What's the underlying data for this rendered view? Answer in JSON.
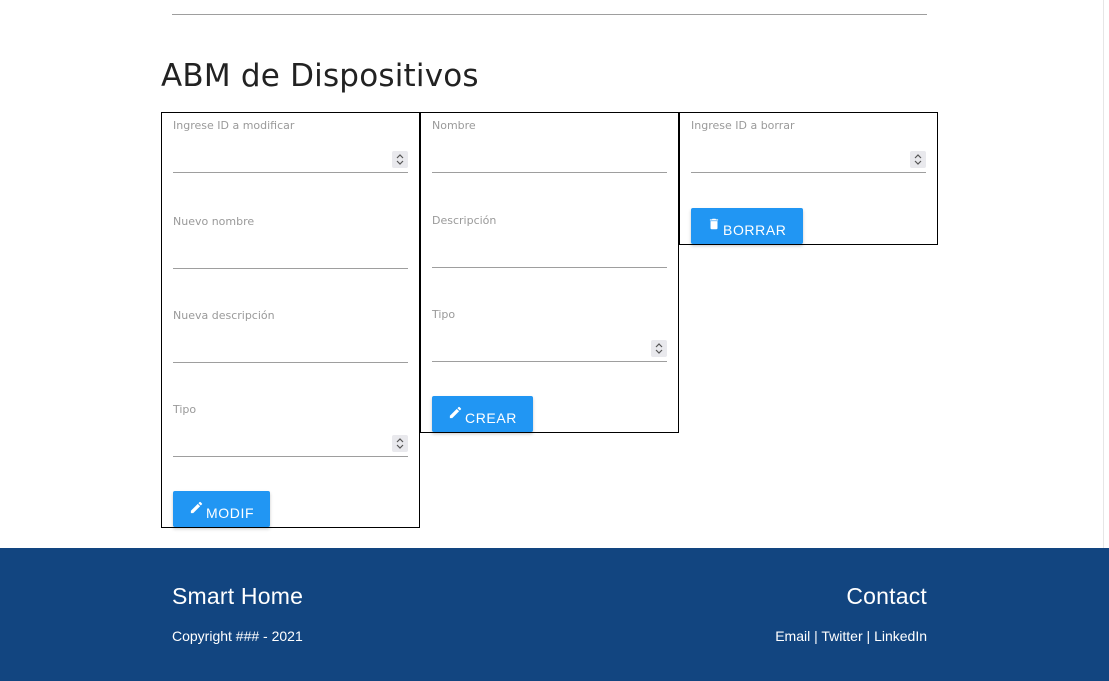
{
  "page": {
    "title": "ABM de Dispositivos"
  },
  "modify_panel": {
    "id_label": "Ingrese ID a modificar",
    "name_label": "Nuevo nombre",
    "description_label": "Nueva descripción",
    "type_label": "Tipo",
    "button_label": "MODIF",
    "button_icon": "pencil-icon"
  },
  "create_panel": {
    "name_label": "Nombre",
    "description_label": "Descripción",
    "type_label": "Tipo",
    "button_label": "CREAR",
    "button_icon": "pencil-icon"
  },
  "delete_panel": {
    "id_label": "Ingrese ID a borrar",
    "button_label": "BORRAR",
    "button_icon": "trash-icon"
  },
  "footer": {
    "brand": "Smart Home",
    "copyright": "Copyright ### - 2021",
    "contact_title": "Contact",
    "links": {
      "email": "Email",
      "twitter": "Twitter",
      "linkedin": "LinkedIn",
      "separator": "|"
    }
  },
  "colors": {
    "primary_button": "#2196f3",
    "footer_background": "#124580",
    "panel_border": "#000000"
  }
}
